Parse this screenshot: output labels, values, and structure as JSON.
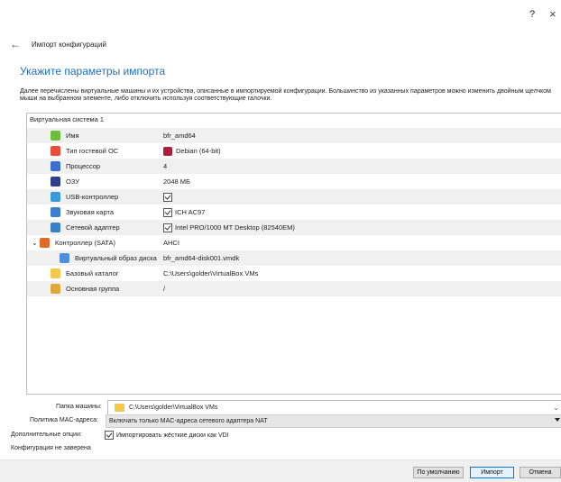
{
  "window": {
    "help_label": "?",
    "close_label": "×"
  },
  "nav": {
    "back_label": "←",
    "title": "Импорт конфигураций"
  },
  "heading": "Укажите параметры импорта",
  "description": "Далее перечислены виртуальные машины и их устройства, описанные в импортируемой конфигурации. Большинство из указанных параметров можно изменить двойным щелчком мыши на выбранном элементе, либо отключить используя соответствующие галочки.",
  "tree": {
    "root_label": "Виртуальная система 1",
    "rows": [
      {
        "name": "Имя",
        "value": "bfr_amd64",
        "icon": "name-icon",
        "icon_color": "#6bbf3a"
      },
      {
        "name": "Тип гостевой ОС",
        "value": "Debian (64-bit)",
        "icon": "os-type-icon",
        "icon_color": "#e94e3c",
        "value_icon": "debian-icon"
      },
      {
        "name": "Процессор",
        "value": "4",
        "icon": "cpu-icon",
        "icon_color": "#3b6fd6"
      },
      {
        "name": "ОЗУ",
        "value": "2048 МБ",
        "icon": "ram-icon",
        "icon_color": "#2b3f8c"
      },
      {
        "name": "USB-контроллер",
        "value": "",
        "icon": "usb-icon",
        "icon_color": "#3a9ad9",
        "checkbox": true
      },
      {
        "name": "Звуковая карта",
        "value": "ICH AC97",
        "icon": "audio-icon",
        "icon_color": "#3a7fd0",
        "checkbox": true
      },
      {
        "name": "Сетевой адаптер",
        "value": "Intel PRO/1000 MT Desktop (82540EM)",
        "icon": "network-icon",
        "icon_color": "#3d7fc5",
        "checkbox": true
      },
      {
        "name": "Контроллер (SATA)",
        "value": "AHCI",
        "icon": "sata-controller-icon",
        "icon_color": "#e06a2a",
        "expanded": true
      },
      {
        "name": "Виртуальный образ диска",
        "value": "bfr_amd64-disk001.vmdk",
        "icon": "disk-image-icon",
        "icon_color": "#4f8fe0"
      },
      {
        "name": "Базовый каталог",
        "value": "C:\\Users\\golder\\VirtualBox VMs",
        "icon": "folder-icon",
        "icon_color": "#f2c94c"
      },
      {
        "name": "Основная группа",
        "value": "/",
        "icon": "group-icon",
        "icon_color": "#e0a93a"
      }
    ],
    "expand_glyph": "⌄"
  },
  "machine_folder": {
    "label": "Папка машины:",
    "value": "C:\\Users\\golder\\VirtualBox VMs",
    "chevron": "⌄"
  },
  "mac_policy": {
    "label": "Политика MAC-адреса:",
    "value": "Включать только MAC-адреса сетевого адаптера NAT"
  },
  "additional": {
    "label": "Дополнительные опции:",
    "option": "Импортировать жёсткие диски как VDI",
    "checked": true
  },
  "status": "Конфигурация не заверена",
  "buttons": {
    "defaults": "По умолчанию",
    "import": "Импорт",
    "cancel": "Отмена"
  }
}
